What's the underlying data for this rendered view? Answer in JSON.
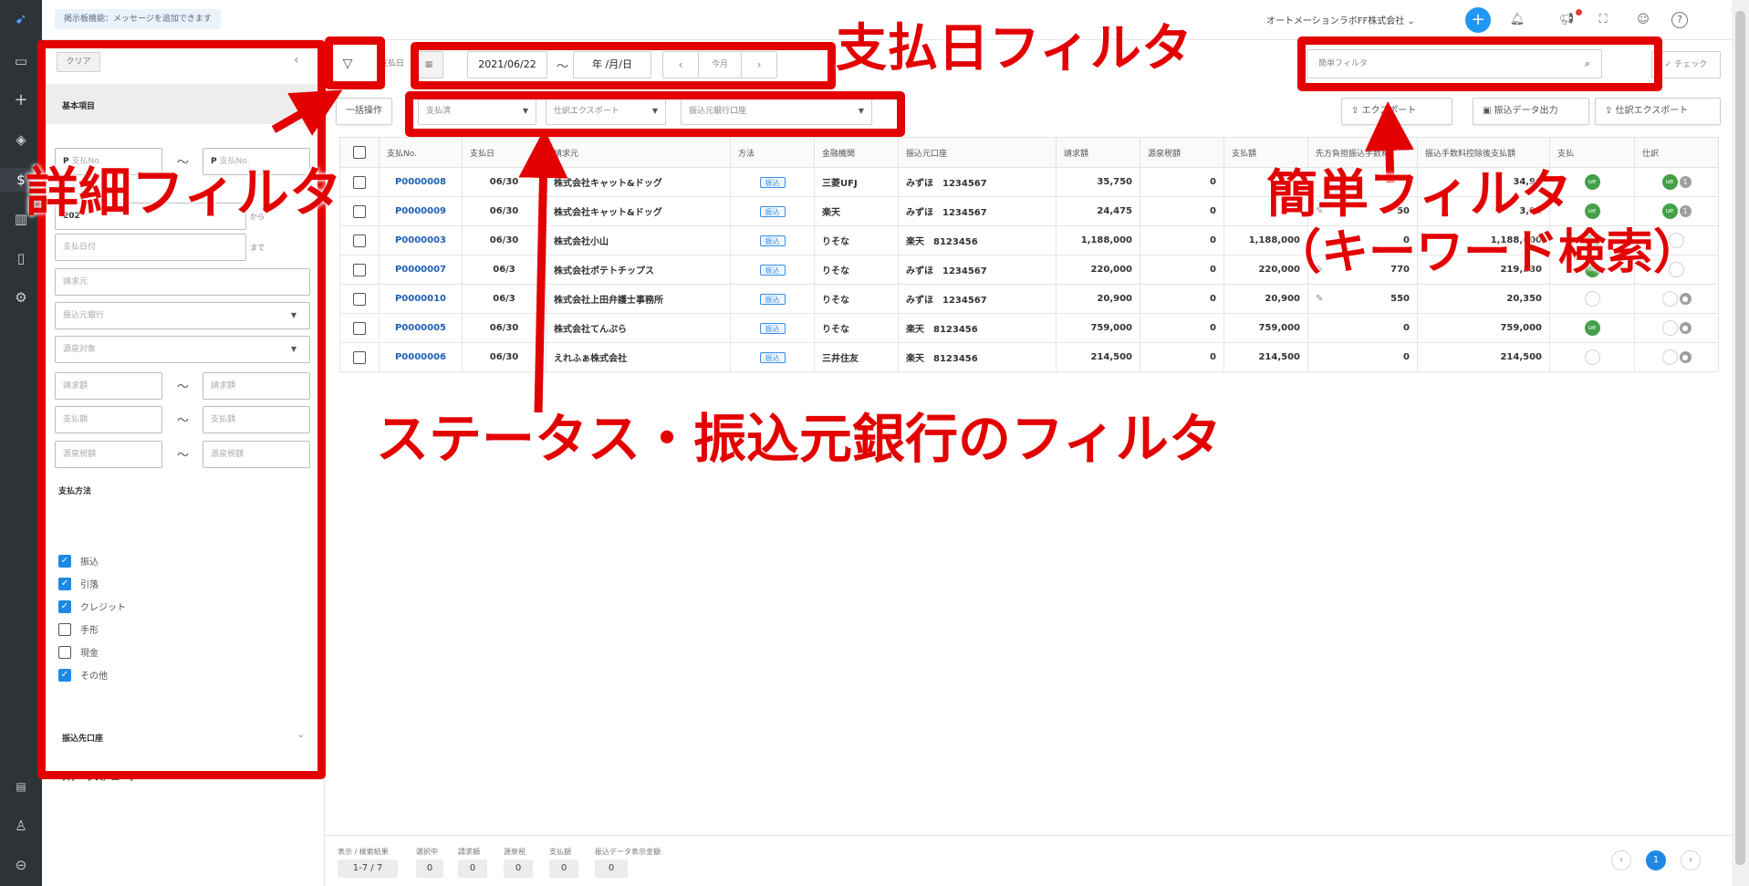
{
  "topbar": {
    "notice": "掲示板機能：メッセージを追加できます",
    "company": "オートメーションラボFF株式会社",
    "icons": [
      "chevron-down-icon",
      "plus-icon",
      "bell-icon",
      "megaphone-icon",
      "fullscreen-icon",
      "support-icon",
      "help-icon"
    ],
    "plus_label": "+",
    "help_label": "?"
  },
  "sidebar": {
    "clear_label": "クリア",
    "collapse_label": "‹",
    "section_title": "基本項目",
    "payno_from_placeholder": "支払No.",
    "payno_to_placeholder": "支払No.",
    "prefix_p": "P",
    "date_from_value": "202",
    "date_from_suffix": "から",
    "date_to_placeholder": "支払日付",
    "date_to_suffix": "まで",
    "client_placeholder": "請求元",
    "bank_placeholder": "振込元銀行",
    "withholding_placeholder": "源泉対象",
    "invoice_from": "請求額",
    "invoice_to": "請求額",
    "pay_from": "支払額",
    "pay_to": "支払額",
    "tax_from": "源泉税額",
    "tax_to": "源泉税額",
    "tilde": "〜",
    "method_title": "支払方法",
    "methods": [
      {
        "label": "振込",
        "checked": true
      },
      {
        "label": "引落",
        "checked": true
      },
      {
        "label": "クレジット",
        "checked": true
      },
      {
        "label": "手形",
        "checked": false
      },
      {
        "label": "現金",
        "checked": false
      },
      {
        "label": "その他",
        "checked": true
      }
    ],
    "dest_title": "振込先口座",
    "status_title": "ステータス／ユーザ",
    "expand_glyph": "⌄"
  },
  "toolbar": {
    "filter_icon": "funnel-icon",
    "paydate_label": "支払日",
    "date_from": "2021/06/22",
    "tilde": "〜",
    "date_to": "年 /月/日",
    "prev": "‹",
    "this_month": "今月",
    "next": "›",
    "simple_filter_placeholder": "簡単フィルタ",
    "check_label": "チェック",
    "bulk_label": "一括操作",
    "status_dd": "支払済",
    "journal_dd": "仕訳エクスポート",
    "bank_dd": "振込元銀行口座",
    "export_label": "エクスポート",
    "transfer_label": "振込データ出力",
    "journal_export_label": "仕訳エクスポート"
  },
  "table": {
    "headers": [
      "支払No.",
      "支払日",
      "請求元",
      "方法",
      "金融機関",
      "振込元口座",
      "請求額",
      "源泉税額",
      "支払額",
      "先方負担振込手数料",
      "振込手数料控除後支払額",
      "支払",
      "仕訳"
    ],
    "rows": [
      {
        "no": "P0000008",
        "date": "06/30",
        "client": "株式会社キャット&ドッグ",
        "method": "振込",
        "bank": "三菱UFJ",
        "acct": "みずほ　1234567",
        "invoice": "35,750",
        "tax": "0",
        "pay": "",
        "fee": "",
        "net": "34,98",
        "paid": "ue",
        "journal": "ue",
        "jcount": "1"
      },
      {
        "no": "P0000009",
        "date": "06/30",
        "client": "株式会社キャット&ドッグ",
        "method": "振込",
        "bank": "楽天",
        "acct": "みずほ　1234567",
        "invoice": "24,475",
        "tax": "0",
        "pay": "",
        "fee": "50",
        "net": "3,92",
        "paid": "ue",
        "journal": "ue",
        "jcount": "1"
      },
      {
        "no": "P0000003",
        "date": "06/30",
        "client": "株式会社小山",
        "method": "振込",
        "bank": "りそな",
        "acct": "楽天　8123456",
        "invoice": "1,188,000",
        "tax": "0",
        "pay": "1,188,000",
        "fee": "0",
        "net": "1,188,000",
        "paid": "ue",
        "journal": "",
        "jcount": ""
      },
      {
        "no": "P0000007",
        "date": "06/3",
        "client": "株式会社ポテトチップス",
        "method": "振込",
        "bank": "りそな",
        "acct": "みずほ　1234567",
        "invoice": "220,000",
        "tax": "0",
        "pay": "220,000",
        "fee": "770",
        "net": "219,230",
        "paid": "ue",
        "journal": "",
        "jcount": ""
      },
      {
        "no": "P0000010",
        "date": "06/3",
        "client": "株式会社上田弁護士事務所",
        "method": "振込",
        "bank": "りそな",
        "acct": "みずほ　1234567",
        "invoice": "20,900",
        "tax": "0",
        "pay": "20,900",
        "fee": "550",
        "net": "20,350",
        "paid": "",
        "journal": "",
        "jcount": "●"
      },
      {
        "no": "P0000005",
        "date": "06/30",
        "client": "株式会社てんぷら",
        "method": "振込",
        "bank": "りそな",
        "acct": "楽天　8123456",
        "invoice": "759,000",
        "tax": "0",
        "pay": "759,000",
        "fee": "0",
        "net": "759,000",
        "paid": "ue",
        "journal": "",
        "jcount": "●"
      },
      {
        "no": "P0000006",
        "date": "06/30",
        "client": "えれふぁ株式会社",
        "method": "振込",
        "bank": "三井住友",
        "acct": "楽天　8123456",
        "invoice": "214,500",
        "tax": "0",
        "pay": "214,500",
        "fee": "0",
        "net": "214,500",
        "paid": "",
        "journal": "",
        "jcount": "●"
      }
    ]
  },
  "footer": {
    "labels": [
      "表示 / 検索結果",
      "選択中",
      "請求額",
      "源泉税",
      "支払額",
      "振込データ表示金額"
    ],
    "values": [
      "1-7 / 7",
      "0",
      "0",
      "0",
      "0",
      "0"
    ],
    "page": "1",
    "prev": "‹",
    "next": "›"
  },
  "annotations": {
    "detail": "詳細フィルタ",
    "paydate": "支払日フィルタ",
    "simple1": "簡単フィルタ",
    "simple2": "（キーワード検索）",
    "status": "ステータス・振込元銀行のフィルタ",
    "color": "#e30000"
  }
}
